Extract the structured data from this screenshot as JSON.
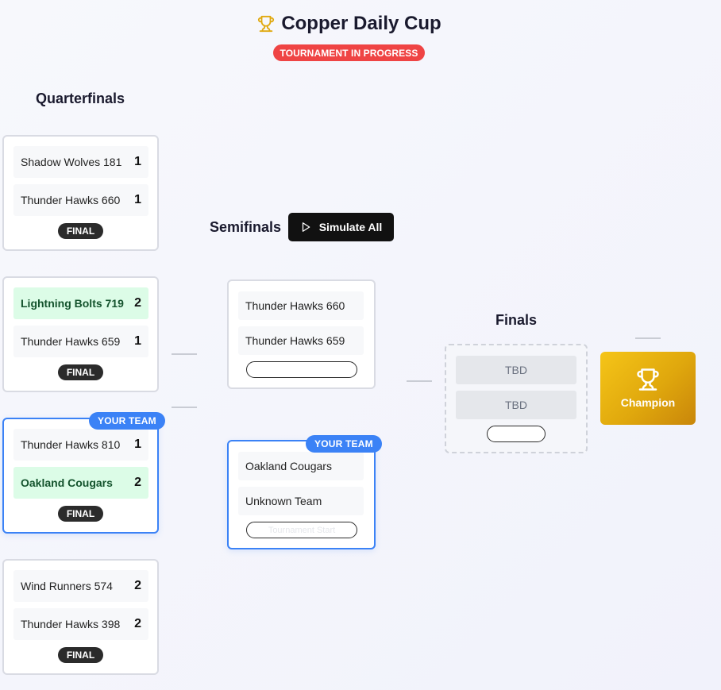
{
  "header": {
    "title": "Copper Daily Cup",
    "status": "TOURNAMENT IN PROGRESS"
  },
  "rounds": {
    "quarterfinals": "Quarterfinals",
    "semifinals": "Semifinals",
    "finals": "Finals"
  },
  "actions": {
    "simulate_all": "Simulate All"
  },
  "labels": {
    "final_badge": "FINAL",
    "your_team": "YOUR TEAM",
    "tbd": "TBD",
    "champion": "Champion",
    "semi_pending": "Tournament Start"
  },
  "quarterfinals": [
    {
      "teams": [
        {
          "name": "Shadow Wolves 181",
          "score": "1",
          "winner": false
        },
        {
          "name": "Thunder Hawks 660",
          "score": "1",
          "winner": false
        }
      ],
      "status": "FINAL",
      "your_team": false
    },
    {
      "teams": [
        {
          "name": "Lightning Bolts 719",
          "score": "2",
          "winner": true
        },
        {
          "name": "Thunder Hawks 659",
          "score": "1",
          "winner": false
        }
      ],
      "status": "FINAL",
      "your_team": false
    },
    {
      "teams": [
        {
          "name": "Thunder Hawks 810",
          "score": "1",
          "winner": false
        },
        {
          "name": "Oakland Cougars",
          "score": "2",
          "winner": true
        }
      ],
      "status": "FINAL",
      "your_team": true
    },
    {
      "teams": [
        {
          "name": "Wind Runners 574",
          "score": "2",
          "winner": false
        },
        {
          "name": "Thunder Hawks 398",
          "score": "2",
          "winner": false
        }
      ],
      "status": "FINAL",
      "your_team": false
    }
  ],
  "semifinals": [
    {
      "teams": [
        "Thunder Hawks 660",
        "Thunder Hawks 659"
      ],
      "your_team": false
    },
    {
      "teams": [
        "Oakland Cougars",
        "Unknown Team"
      ],
      "your_team": true
    }
  ],
  "finals": {
    "teams": [
      "TBD",
      "TBD"
    ]
  },
  "colors": {
    "accent_blue": "#3b82f6",
    "status_red": "#ef4444",
    "win_green": "#dcfce7",
    "gold": "#e0a80d"
  },
  "icons": {
    "title": "trophy-icon",
    "simulate": "play-icon",
    "champion": "trophy-icon"
  }
}
